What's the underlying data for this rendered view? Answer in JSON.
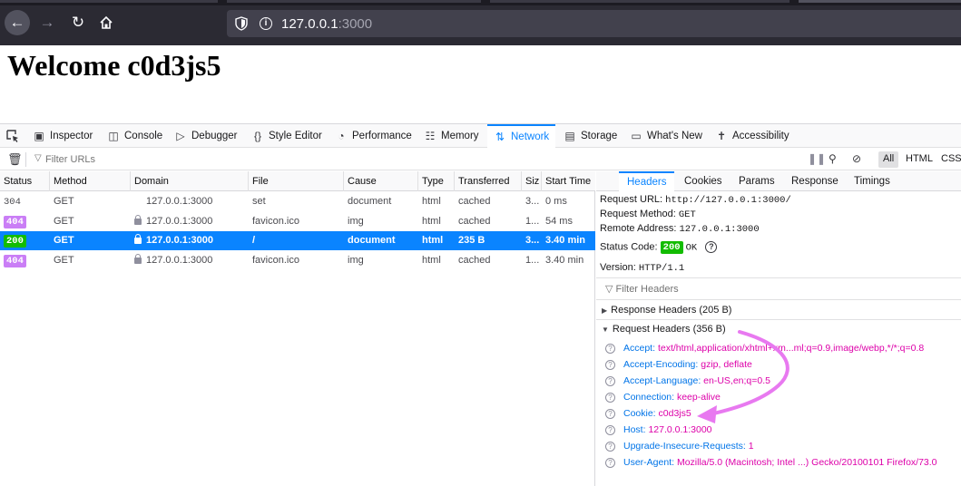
{
  "browser": {
    "url_host": "127.0.0.1",
    "url_port": ":3000"
  },
  "page": {
    "heading": "Welcome c0d3js5"
  },
  "devtools": {
    "tabs": [
      {
        "label": "Inspector",
        "icon": "inspector-icon"
      },
      {
        "label": "Console",
        "icon": "console-icon"
      },
      {
        "label": "Debugger",
        "icon": "debugger-icon"
      },
      {
        "label": "Style Editor",
        "icon": "style-editor-icon"
      },
      {
        "label": "Performance",
        "icon": "performance-icon"
      },
      {
        "label": "Memory",
        "icon": "memory-icon"
      },
      {
        "label": "Network",
        "icon": "network-icon"
      },
      {
        "label": "Storage",
        "icon": "storage-icon"
      },
      {
        "label": "What's New",
        "icon": "whats-new-icon"
      },
      {
        "label": "Accessibility",
        "icon": "accessibility-icon"
      }
    ],
    "active_tab": "Network",
    "filter_placeholder": "Filter URLs",
    "type_filters": [
      "All",
      "HTML",
      "CSS"
    ],
    "table": {
      "columns": [
        "Status",
        "Method",
        "Domain",
        "File",
        "Cause",
        "Type",
        "Transferred",
        "Siz",
        "Start Time"
      ],
      "rows": [
        {
          "status": "304",
          "method": "GET",
          "domain": "127.0.0.1:3000",
          "secure": false,
          "file": "set",
          "cause": "document",
          "type": "html",
          "transferred": "cached",
          "size": "3...",
          "start": "0 ms",
          "selected": false
        },
        {
          "status": "404",
          "method": "GET",
          "domain": "127.0.0.1:3000",
          "secure": true,
          "file": "favicon.ico",
          "cause": "img",
          "type": "html",
          "transferred": "cached",
          "size": "1...",
          "start": "54 ms",
          "selected": false
        },
        {
          "status": "200",
          "method": "GET",
          "domain": "127.0.0.1:3000",
          "secure": true,
          "file": "/",
          "cause": "document",
          "type": "html",
          "transferred": "235 B",
          "size": "3...",
          "start": "3.40 min",
          "selected": true
        },
        {
          "status": "404",
          "method": "GET",
          "domain": "127.0.0.1:3000",
          "secure": true,
          "file": "favicon.ico",
          "cause": "img",
          "type": "html",
          "transferred": "cached",
          "size": "1...",
          "start": "3.40 min",
          "selected": false
        }
      ]
    },
    "side_panel": {
      "tabs": [
        "Headers",
        "Cookies",
        "Params",
        "Response",
        "Timings"
      ],
      "active_tab": "Headers",
      "request_url_label": "Request URL:",
      "request_url": "http://127.0.0.1:3000/",
      "request_method_label": "Request Method:",
      "request_method": "GET",
      "remote_address_label": "Remote Address:",
      "remote_address": "127.0.0.1:3000",
      "status_code_label": "Status Code:",
      "status_code": "200",
      "status_text": "OK",
      "version_label": "Version:",
      "version": "HTTP/1.1",
      "filter_headers_placeholder": "Filter Headers",
      "response_headers_title": "Response Headers (205 B)",
      "request_headers_title": "Request Headers (356 B)",
      "request_headers": [
        {
          "name": "Accept:",
          "value": "text/html,application/xhtml+xm...ml;q=0.9,image/webp,*/*;q=0.8"
        },
        {
          "name": "Accept-Encoding:",
          "value": "gzip, deflate"
        },
        {
          "name": "Accept-Language:",
          "value": "en-US,en;q=0.5"
        },
        {
          "name": "Connection:",
          "value": "keep-alive"
        },
        {
          "name": "Cookie:",
          "value": "c0d3js5"
        },
        {
          "name": "Host:",
          "value": "127.0.0.1:3000"
        },
        {
          "name": "Upgrade-Insecure-Requests:",
          "value": "1"
        },
        {
          "name": "User-Agent:",
          "value": "Mozilla/5.0 (Macintosh; Intel ...) Gecko/20100101 Firefox/73.0"
        }
      ]
    }
  },
  "annotation_color": "#e879f0"
}
